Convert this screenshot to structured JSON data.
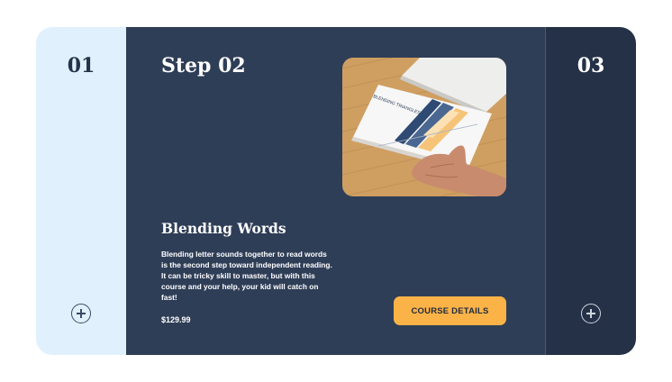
{
  "steps": [
    {
      "number": "01"
    },
    {
      "step_label": "Step 02",
      "course_title": "Blending Words",
      "description": "Blending letter sounds together to read words is the second step toward independent reading. It can be tricky skill to master, but with this course and your help, your kid will catch on fast!",
      "price": "$129.99",
      "cta_label": "COURSE DETAILS",
      "image": {
        "worksheet_text": "BLENDING TRIANGLES"
      }
    },
    {
      "number": "03"
    }
  ],
  "icons": {
    "expand": "plus-circle-icon"
  },
  "colors": {
    "panel_light": "#e0f1fd",
    "panel_main": "#2f3e57",
    "panel_dark": "#243147",
    "accent": "#fbb347"
  }
}
